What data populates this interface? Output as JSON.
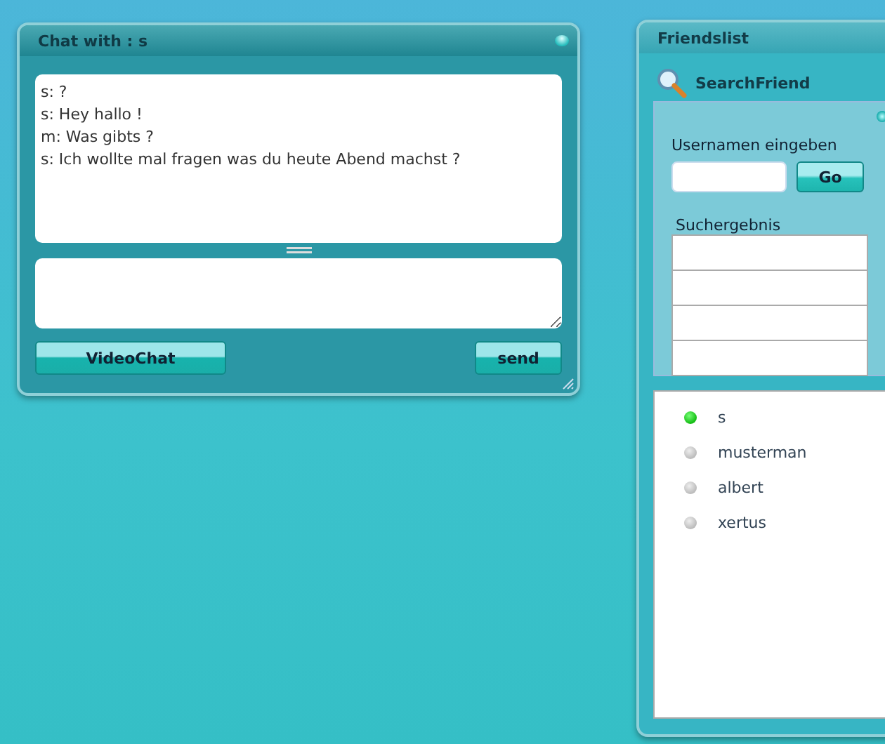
{
  "chat_window": {
    "title": "Chat with : s",
    "messages": [
      "s: ?",
      "s: Hey hallo !",
      "m: Was gibts ?",
      "s: Ich wollte mal fragen was du heute Abend machst ?"
    ],
    "buttons": [
      "VideoChat",
      "send"
    ]
  },
  "friendslist": {
    "title": "Friendslist",
    "search_title": "SearchFriend",
    "username_label": "Usernamen eingeben",
    "go_button": "Go",
    "results_label": "Suchergebnis",
    "friends": [
      {
        "name": "s",
        "online": true
      },
      {
        "name": "musterman",
        "online": false
      },
      {
        "name": "albert",
        "online": false
      },
      {
        "name": "xertus",
        "online": false
      }
    ]
  }
}
